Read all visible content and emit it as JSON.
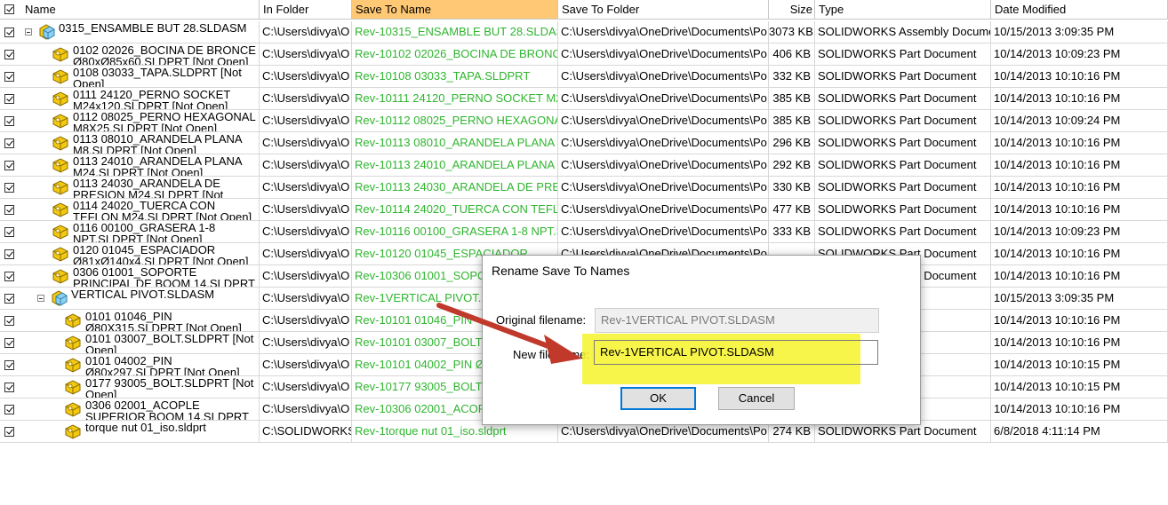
{
  "columns": {
    "name": "Name",
    "in_folder": "In Folder",
    "save_to_name": "Save To Name",
    "save_to_folder": "Save To Folder",
    "size": "Size",
    "type": "Type",
    "date_modified": "Date Modified"
  },
  "rows": [
    {
      "name_text": "0315_ENSAMBLE BUT 28.SLDASM",
      "in_folder": "C:\\Users\\divya\\O",
      "save_to_name": "Rev-10315_ENSAMBLE BUT 28.SLDASM",
      "save_to_folder": "C:\\Users\\divya\\OneDrive\\Documents\\Po",
      "size": "3073 KB",
      "type": "SOLIDWORKS Assembly Docume",
      "date": "10/15/2013 3:09:35 PM"
    },
    {
      "name_text": "0102 02026_BOCINA DE BRONCE Ø80xØ85x60.SLDPRT [Not Open]",
      "in_folder": "C:\\Users\\divya\\O",
      "save_to_name": "Rev-10102 02026_BOCINA DE BRONCE",
      "save_to_folder": "C:\\Users\\divya\\OneDrive\\Documents\\Po",
      "size": "406 KB",
      "type": "SOLIDWORKS Part Document",
      "date": "10/14/2013 10:09:23 PM"
    },
    {
      "name_text": "0108 03033_TAPA.SLDPRT [Not Open]",
      "in_folder": "C:\\Users\\divya\\O",
      "save_to_name": "Rev-10108 03033_TAPA.SLDPRT",
      "save_to_folder": "C:\\Users\\divya\\OneDrive\\Documents\\Po",
      "size": "332 KB",
      "type": "SOLIDWORKS Part Document",
      "date": "10/14/2013 10:10:16 PM"
    },
    {
      "name_text": "0111 24120_PERNO SOCKET M24x120.SLDPRT [Not Open]",
      "in_folder": "C:\\Users\\divya\\O",
      "save_to_name": "Rev-10111 24120_PERNO SOCKET M24",
      "save_to_folder": "C:\\Users\\divya\\OneDrive\\Documents\\Po",
      "size": "385 KB",
      "type": "SOLIDWORKS Part Document",
      "date": "10/14/2013 10:10:16 PM"
    },
    {
      "name_text": "0112 08025_PERNO HEXAGONAL M8X25.SLDPRT [Not Open]",
      "in_folder": "C:\\Users\\divya\\O",
      "save_to_name": "Rev-10112 08025_PERNO HEXAGONAL",
      "save_to_folder": "C:\\Users\\divya\\OneDrive\\Documents\\Po",
      "size": "385 KB",
      "type": "SOLIDWORKS Part Document",
      "date": "10/14/2013 10:09:24 PM"
    },
    {
      "name_text": "0113 08010_ARANDELA PLANA M8.SLDPRT [Not Open]",
      "in_folder": "C:\\Users\\divya\\O",
      "save_to_name": "Rev-10113 08010_ARANDELA PLANA M",
      "save_to_folder": "C:\\Users\\divya\\OneDrive\\Documents\\Po",
      "size": "296 KB",
      "type": "SOLIDWORKS Part Document",
      "date": "10/14/2013 10:10:16 PM"
    },
    {
      "name_text": "0113 24010_ARANDELA PLANA M24.SLDPRT [Not Open]",
      "in_folder": "C:\\Users\\divya\\O",
      "save_to_name": "Rev-10113 24010_ARANDELA PLANA M",
      "save_to_folder": "C:\\Users\\divya\\OneDrive\\Documents\\Po",
      "size": "292 KB",
      "type": "SOLIDWORKS Part Document",
      "date": "10/14/2013 10:10:16 PM"
    },
    {
      "name_text": "0113 24030_ARANDELA DE PRESION M24.SLDPRT [Not Open]",
      "in_folder": "C:\\Users\\divya\\O",
      "save_to_name": "Rev-10113 24030_ARANDELA DE PRESI",
      "save_to_folder": "C:\\Users\\divya\\OneDrive\\Documents\\Po",
      "size": "330 KB",
      "type": "SOLIDWORKS Part Document",
      "date": "10/14/2013 10:10:16 PM"
    },
    {
      "name_text": "0114 24020_TUERCA CON TEFLON M24.SLDPRT [Not Open]",
      "in_folder": "C:\\Users\\divya\\O",
      "save_to_name": "Rev-10114 24020_TUERCA CON TEFLO",
      "save_to_folder": "C:\\Users\\divya\\OneDrive\\Documents\\Po",
      "size": "477 KB",
      "type": "SOLIDWORKS Part Document",
      "date": "10/14/2013 10:10:16 PM"
    },
    {
      "name_text": "0116 00100_GRASERA 1-8 NPT.SLDPRT [Not Open]",
      "in_folder": "C:\\Users\\divya\\O",
      "save_to_name": "Rev-10116 00100_GRASERA 1-8 NPT.SL",
      "save_to_folder": "C:\\Users\\divya\\OneDrive\\Documents\\Po",
      "size": "333 KB",
      "type": "SOLIDWORKS Part Document",
      "date": "10/14/2013 10:09:23 PM"
    },
    {
      "name_text": "0120 01045_ESPACIADOR Ø81xØ140x4.SLDPRT [Not Open]",
      "in_folder": "C:\\Users\\divya\\O",
      "save_to_name": "Rev-10120 01045_ESPACIADOR",
      "save_to_folder": "C:\\Users\\divya\\OneDrive\\Documents\\Po",
      "size": "",
      "type": "SOLIDWORKS Part Document",
      "date": "10/14/2013 10:10:16 PM"
    },
    {
      "name_text": "0306 01001_SOPORTE PRINCIPAL DE BOOM 14.SLDPRT [Not Open]",
      "in_folder": "C:\\Users\\divya\\O",
      "save_to_name": "Rev-10306 01001_SOPORT",
      "save_to_folder": "",
      "size": "",
      "type": "SOLIDWORKS Part Document",
      "date": "10/14/2013 10:10:16 PM"
    },
    {
      "name_text": "VERTICAL PIVOT.SLDASM",
      "in_folder": "C:\\Users\\divya\\O",
      "save_to_name": "Rev-1VERTICAL PIVOT.SL",
      "save_to_folder": "",
      "size": "",
      "type": "ssembly Docume",
      "date": "10/15/2013 3:09:35 PM"
    },
    {
      "name_text": "0101 01046_PIN Ø80X315.SLDPRT [Not Open]",
      "in_folder": "C:\\Users\\divya\\O",
      "save_to_name": "Rev-10101 01046_PIN",
      "save_to_folder": "",
      "size": "",
      "type": "t Document",
      "date": "10/14/2013 10:10:16 PM"
    },
    {
      "name_text": "0101 03007_BOLT.SLDPRT [Not Open]",
      "in_folder": "C:\\Users\\divya\\O",
      "save_to_name": "Rev-10101 03007_BOLT.S",
      "save_to_folder": "",
      "size": "",
      "type": "t Document",
      "date": "10/14/2013 10:10:16 PM"
    },
    {
      "name_text": "0101 04002_PIN Ø80x297.SLDPRT [Not Open]",
      "in_folder": "C:\\Users\\divya\\O",
      "save_to_name": "Rev-10101 04002_PIN Ø8",
      "save_to_folder": "",
      "size": "",
      "type": "t Document",
      "date": "10/14/2013 10:10:15 PM"
    },
    {
      "name_text": "0177 93005_BOLT.SLDPRT [Not Open]",
      "in_folder": "C:\\Users\\divya\\O",
      "save_to_name": "Rev-10177 93005_BOLT.S",
      "save_to_folder": "",
      "size": "",
      "type": "t Document",
      "date": "10/14/2013 10:10:15 PM"
    },
    {
      "name_text": "0306 02001_ACOPLE SUPERIOR BOOM 14.SLDPRT [Not Open]",
      "in_folder": "C:\\Users\\divya\\O",
      "save_to_name": "Rev-10306 02001_ACOPL",
      "save_to_folder": "",
      "size": "",
      "type": "t Document",
      "date": "10/14/2013 10:10:16 PM"
    },
    {
      "name_text": "torque nut 01_iso.sldprt",
      "in_folder": "C:\\SOLIDWORKS",
      "save_to_name": "Rev-1torque nut 01_iso.sldprt",
      "save_to_folder": "C:\\Users\\divya\\OneDrive\\Documents\\Po",
      "size": "274 KB",
      "type": "SOLIDWORKS Part Document",
      "date": "6/8/2018 4:11:14 PM"
    }
  ],
  "dialog": {
    "title": "Rename Save To Names",
    "original_label": "Original filename:",
    "original_value": "Rev-1VERTICAL PIVOT.SLDASM",
    "new_label": "New file name:",
    "new_value": "Rev-1VERTICAL PIVOT.SLDASM",
    "ok_label": "OK",
    "cancel_label": "Cancel"
  },
  "colors": {
    "selected_header": "#ffc874",
    "save_to_name_text": "#2fb52f",
    "highlight": "#f7f32a",
    "arrow": "#c0392b"
  },
  "icons": {
    "assembly": "assembly-icon",
    "part": "part-icon",
    "checkbox": "checkbox-checked-icon",
    "collapse": "collapse-icon",
    "arrow": "annotation-arrow-icon"
  }
}
